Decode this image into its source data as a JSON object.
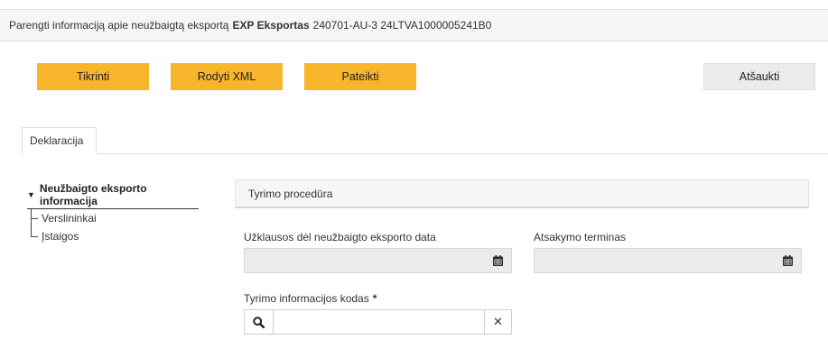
{
  "header": {
    "prefix": "Parengti informaciją apie neužbaigtą eksportą",
    "doc_type": "EXP Eksportas",
    "reference": "240701-AU-3 24LTVA1000005241B0"
  },
  "toolbar": {
    "check_label": "Tikrinti",
    "xml_label": "Rodyti XML",
    "submit_label": "Pateikti",
    "cancel_label": "Atšaukti"
  },
  "tabs": [
    {
      "label": "Deklaracija"
    }
  ],
  "tree": {
    "root": "Neužbaigto eksporto informacija",
    "children": [
      "Verslininkai",
      "Įstaigos"
    ]
  },
  "section": {
    "title": "Tyrimo procedūra"
  },
  "fields": {
    "inquiry_date_label": "Užklausos dėl neužbaigto eksporto data",
    "inquiry_date_value": "",
    "deadline_label": "Atsakymo terminas",
    "deadline_value": "",
    "research_code_label": "Tyrimo informacijos kodas",
    "research_code_required": "*",
    "research_code_value": ""
  },
  "colors": {
    "primary_button": "#f7b52b",
    "secondary_button": "#ebebeb",
    "readonly_input": "#ebebeb"
  },
  "icons": {
    "caret": "caret-down-icon",
    "calendar": "calendar-icon",
    "search": "search-icon",
    "clear": "close-icon"
  }
}
